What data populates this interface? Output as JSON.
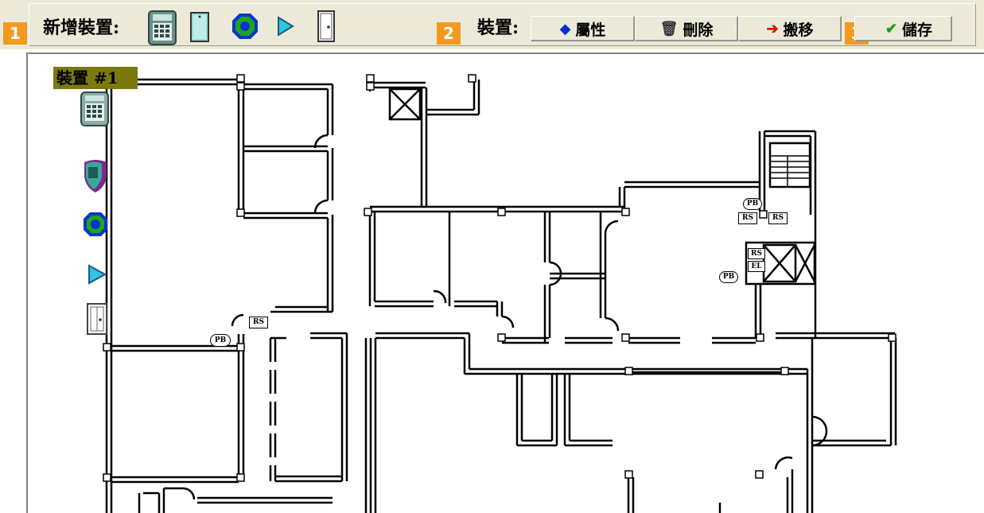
{
  "toolbar": {
    "badge1": "1",
    "badge2": "2",
    "badge3": "3",
    "add_device_label": "新增裝置:",
    "device_label": "裝置:",
    "add_icons": [
      "keypad-icon",
      "door-contact-icon",
      "motion-sensor-icon",
      "play-trigger-icon",
      "door-icon"
    ],
    "buttons": {
      "properties": "屬性",
      "delete": "刪除",
      "move": "搬移",
      "save": "儲存"
    }
  },
  "canvas": {
    "device_tag": "裝置 #1",
    "placed_devices": [
      "keypad-icon",
      "shield-sensor-icon",
      "motion-sensor-icon",
      "play-trigger-icon",
      "door-icon"
    ],
    "plan_labels": {
      "rs": "RS",
      "pb": "PB",
      "el": "EL"
    }
  },
  "colors": {
    "badge": "#f39a1e",
    "toolbar_bg": "#ece9d8",
    "tag_bg": "#7a7a10",
    "accent_blue": "#0b2bd1",
    "accent_red": "#d41111",
    "accent_green": "#1a9a1a"
  }
}
